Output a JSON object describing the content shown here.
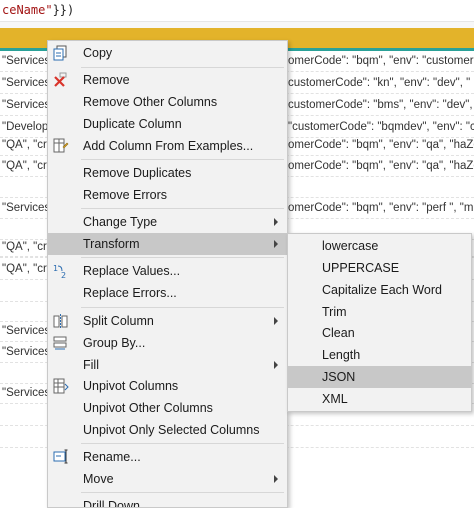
{
  "formula_bar": {
    "text_str": "ceName\"",
    "text_close": "}})"
  },
  "grid": {
    "rows": [
      {
        "left": "\"Services\"",
        "right": "omerCode\": \"bqm\",  \"env\": \"customer"
      },
      {
        "left": "\"Services\"",
        "right": "customerCode\": \"kn\",  \"env\": \"dev\",  \""
      },
      {
        "left": "\"Services\"",
        "right": "customerCode\": \"bms\",  \"env\": \"dev\",  \""
      },
      {
        "left": "\"Developr",
        "right": "\"customerCode\": \"bqmdev\",  \"env\": \"c"
      },
      {
        "left": "\"QA\",  \"cre",
        "right": "omerCode\": \"bqm\",  \"env\": \"qa\",  \"haZone"
      },
      {
        "left": "\"QA\",  \"cre",
        "right": "omerCode\": \"bqm\",  \"env\": \"qa\",  \"haZo"
      },
      {
        "left": "",
        "right": ""
      },
      {
        "left": "\"Services\"",
        "right": "omerCode\": \"bqm\",  \"env\": \"perf \",  \"m"
      },
      {
        "left": "",
        "right": ""
      },
      {
        "left": "",
        "right": ""
      },
      {
        "left": "\"QA\",  \"cre",
        "right": ""
      },
      {
        "left": "\"QA\",  \"cre",
        "right": ""
      },
      {
        "left": "",
        "right": ""
      },
      {
        "left": "",
        "right": ""
      },
      {
        "left": "\"Services\"",
        "right": ""
      },
      {
        "left": "\"Services\"",
        "right": ""
      },
      {
        "left": "",
        "right": ""
      },
      {
        "left": "\"Services\"",
        "right": ""
      },
      {
        "left": "",
        "right": ""
      },
      {
        "left": "",
        "right": ""
      }
    ]
  },
  "context_menu": {
    "items": [
      {
        "label": "Copy",
        "icon": "copy-icon"
      },
      {
        "label": "Remove",
        "icon": "remove-x-icon"
      },
      {
        "label": "Remove Other Columns"
      },
      {
        "label": "Duplicate Column"
      },
      {
        "label": "Add Column From Examples...",
        "icon": "add-column-examples-icon"
      },
      {
        "label": "Remove Duplicates"
      },
      {
        "label": "Remove Errors"
      },
      {
        "label": "Change Type"
      },
      {
        "label": "Transform"
      },
      {
        "label": "Replace Values...",
        "icon": "replace-values-icon"
      },
      {
        "label": "Replace Errors..."
      },
      {
        "label": "Split Column",
        "icon": "split-column-icon"
      },
      {
        "label": "Group By...",
        "icon": "group-by-icon"
      },
      {
        "label": "Fill"
      },
      {
        "label": "Unpivot Columns",
        "icon": "unpivot-icon"
      },
      {
        "label": "Unpivot Other Columns"
      },
      {
        "label": "Unpivot Only Selected Columns"
      },
      {
        "label": "Rename...",
        "icon": "rename-icon"
      },
      {
        "label": "Move"
      },
      {
        "label": "Drill Down"
      }
    ]
  },
  "transform_submenu": {
    "items": [
      {
        "label": "lowercase"
      },
      {
        "label": "UPPERCASE"
      },
      {
        "label": "Capitalize Each Word"
      },
      {
        "label": "Trim"
      },
      {
        "label": "Clean"
      },
      {
        "label": "Length"
      },
      {
        "label": "JSON"
      },
      {
        "label": "XML"
      }
    ]
  },
  "colors": {
    "header_gold": "#e3b32a",
    "header_teal": "#2aa198",
    "menu_bg": "#f2f2f2",
    "menu_highlight": "#c8c8c8",
    "remove_icon_red": "#d9342b",
    "icon_blue": "#2b6cb0"
  }
}
